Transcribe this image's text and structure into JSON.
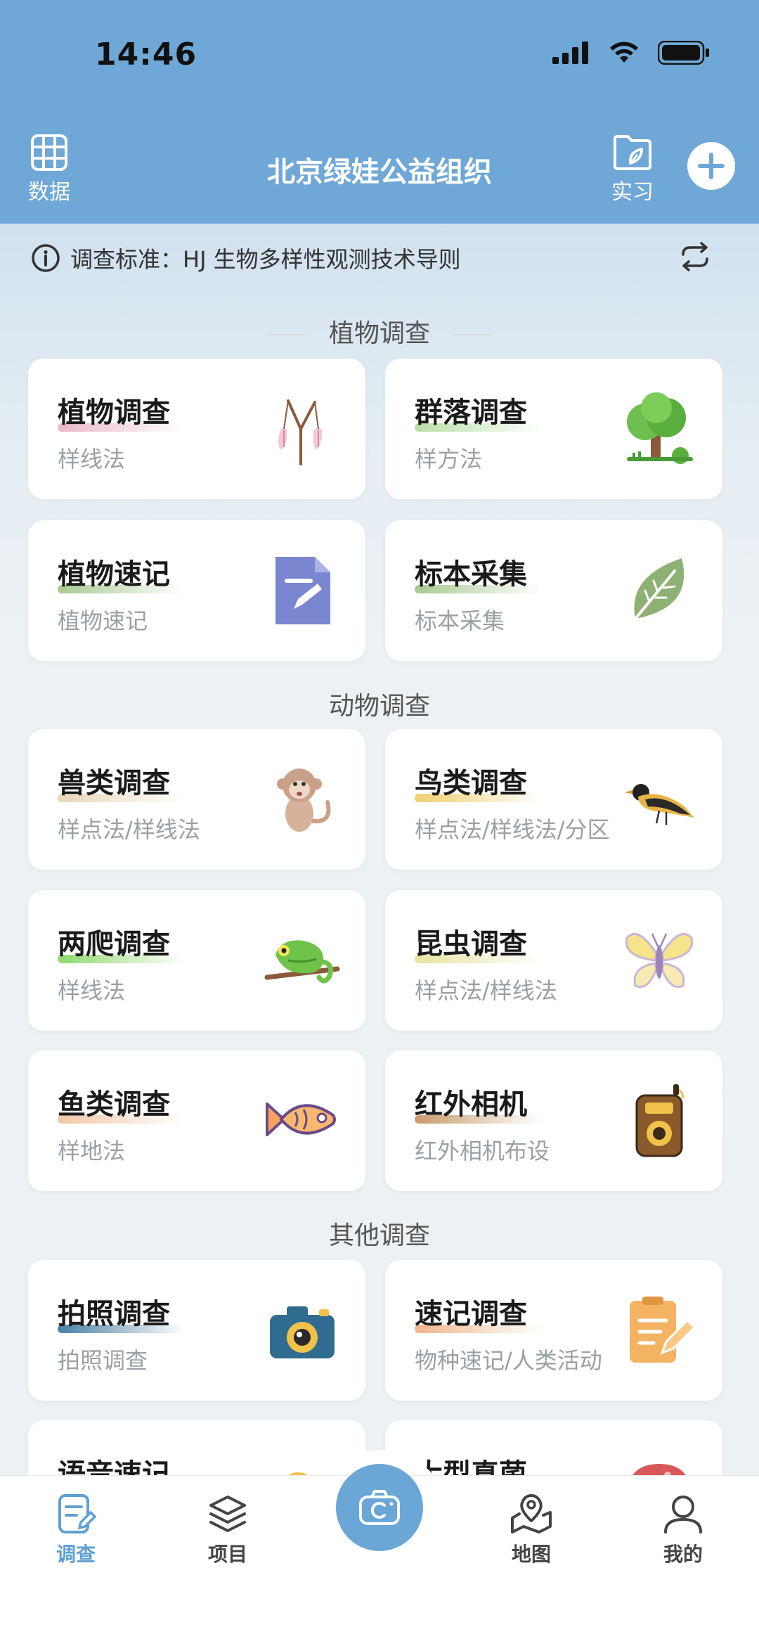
{
  "status_bar": {
    "time": "14:46"
  },
  "header": {
    "title": "北京绿娃公益组织",
    "left_button": {
      "label": "数据",
      "icon": "grid-table-icon"
    },
    "right_button": {
      "label": "实习",
      "icon": "folder-leaf-icon"
    },
    "add_icon": "plus-circle-icon",
    "background": "#6fa8d6"
  },
  "standard": {
    "text": "调查标准：HJ 生物多样性观测技术导则",
    "info_icon": "info-icon",
    "switch_icon": "refresh-icon"
  },
  "sections": [
    {
      "title": "植物调查",
      "cards": [
        {
          "title": "植物调查",
          "subtitle": "样线法",
          "icon": "flower-icon",
          "accent": "#e9b7c8"
        },
        {
          "title": "群落调查",
          "subtitle": "样方法",
          "icon": "tree-icon",
          "accent": "#b7dfa6"
        },
        {
          "title": "植物速记",
          "subtitle": "植物速记",
          "icon": "document-edit-icon",
          "accent": "#a8c990"
        },
        {
          "title": "标本采集",
          "subtitle": "标本采集",
          "icon": "leaf-icon",
          "accent": "#a8c990"
        }
      ]
    },
    {
      "title": "动物调查",
      "cards": [
        {
          "title": "兽类调查",
          "subtitle": "样点法/样线法",
          "icon": "monkey-icon",
          "accent": "#e8d7b8"
        },
        {
          "title": "鸟类调查",
          "subtitle": "样点法/样线法/分区",
          "icon": "bird-icon",
          "accent": "#f0cf70"
        },
        {
          "title": "两爬调查",
          "subtitle": "样线法",
          "icon": "chameleon-icon",
          "accent": "#8fd86f"
        },
        {
          "title": "昆虫调查",
          "subtitle": "样点法/样线法",
          "icon": "butterfly-icon",
          "accent": "#e8e3a0"
        },
        {
          "title": "鱼类调查",
          "subtitle": "样地法",
          "icon": "fish-icon",
          "accent": "#f2c7a6"
        },
        {
          "title": "红外相机",
          "subtitle": "红外相机布设",
          "icon": "trail-camera-icon",
          "accent": "#c99a6c"
        }
      ]
    },
    {
      "title": "其他调查",
      "cards": [
        {
          "title": "拍照调查",
          "subtitle": "拍照调查",
          "icon": "camera-icon",
          "accent": "#4a7fa4"
        },
        {
          "title": "速记调查",
          "subtitle": "物种速记/人类活动",
          "icon": "notes-pen-icon",
          "accent": "#f0b58a"
        },
        {
          "title": "语音速记",
          "subtitle": "",
          "icon": "ai-voice-icon",
          "accent": "#f2d27a"
        },
        {
          "title": "大型真菌",
          "subtitle": "",
          "icon": "mushroom-icon",
          "accent": "#e0a0a0"
        }
      ]
    }
  ],
  "bottom_nav": {
    "tabs": [
      {
        "label": "调查",
        "icon": "survey-icon",
        "active": true
      },
      {
        "label": "项目",
        "icon": "layers-icon",
        "active": false
      },
      {
        "label": "地图",
        "icon": "map-pin-icon",
        "active": false
      },
      {
        "label": "我的",
        "icon": "user-icon",
        "active": false
      }
    ],
    "center_icon": "camera-capture-icon",
    "active_color": "#5fa0d4"
  }
}
